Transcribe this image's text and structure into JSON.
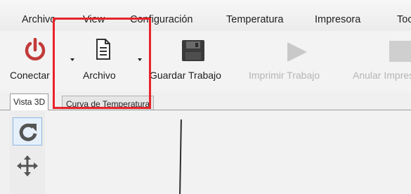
{
  "menu": {
    "items": [
      "Archivo",
      "View",
      "Configuración",
      "Temperatura",
      "Impresora",
      "Too"
    ]
  },
  "toolbar": {
    "connect_label": "Conectar",
    "file_label": "Archivo",
    "save_label": "Guardar Trabajo",
    "print_label": "Imprimir Trabajo",
    "cancel_label": "Anular Impresión",
    "icons": {
      "connect": "power-icon",
      "file": "document-icon",
      "save": "floppy-disk-icon",
      "print": "play-icon",
      "cancel": "stop-icon"
    }
  },
  "tabs": {
    "view3d": "Vista 3D",
    "temp_curve": "Curva de Temperatura"
  },
  "left_tools": [
    "refresh-icon",
    "move-icon"
  ],
  "colors": {
    "power_red": "#c23a3a",
    "highlight_red": "#e8232a",
    "disabled_gray": "#b5b5b5"
  }
}
